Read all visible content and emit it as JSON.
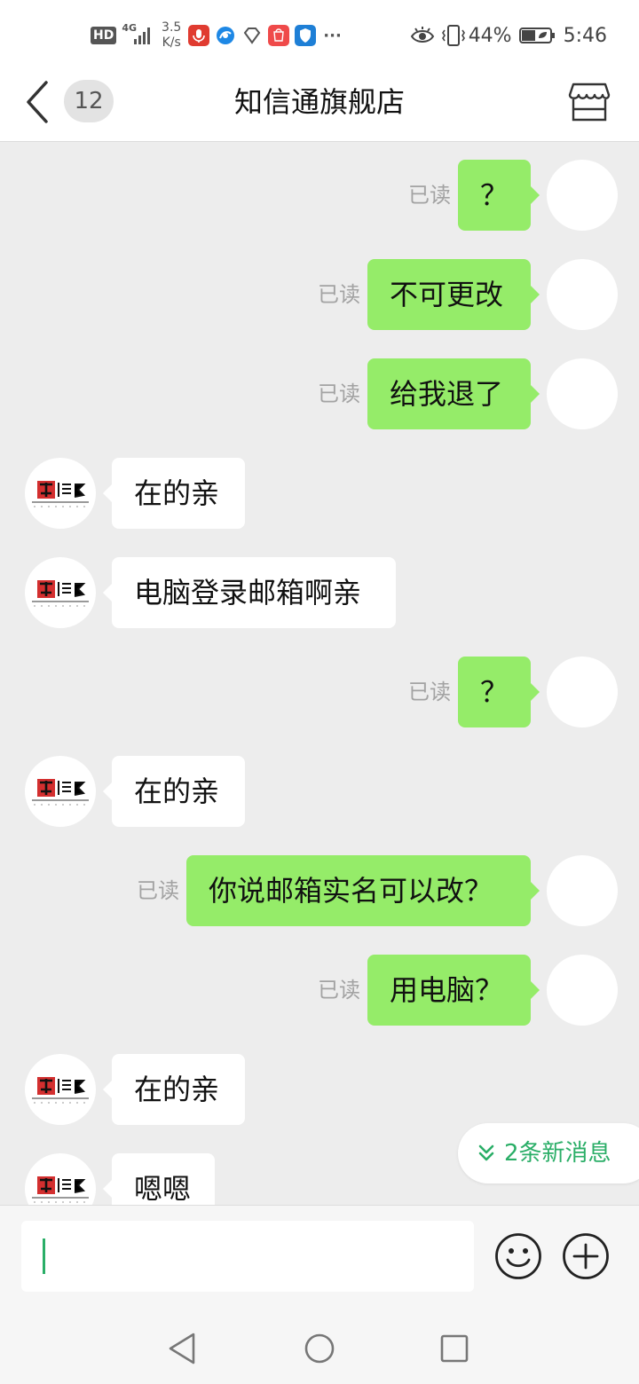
{
  "status_bar": {
    "hd": "HD",
    "network": "4G",
    "speed_value": "3.5",
    "speed_unit": "K/s",
    "more": "···",
    "battery": "44%",
    "time": "5:46"
  },
  "header": {
    "unread_count": "12",
    "title": "知信通旗舰店"
  },
  "messages": [
    {
      "from": "me",
      "text": "？",
      "status": "已读"
    },
    {
      "from": "me",
      "text": "不可更改",
      "status": "已读"
    },
    {
      "from": "me",
      "text": "给我退了",
      "status": "已读"
    },
    {
      "from": "shop",
      "text": "在的亲"
    },
    {
      "from": "shop",
      "text": "电脑登录邮箱啊亲"
    },
    {
      "from": "me",
      "text": "？",
      "status": "已读"
    },
    {
      "from": "shop",
      "text": "在的亲"
    },
    {
      "from": "me",
      "text": "你说邮箱实名可以改？",
      "status": "已读"
    },
    {
      "from": "me",
      "text": "用电脑？",
      "status": "已读"
    },
    {
      "from": "shop",
      "text": "在的亲"
    },
    {
      "from": "shop",
      "text": "嗯嗯"
    }
  ],
  "new_messages": {
    "label": "2条新消息"
  },
  "input": {
    "value": ""
  },
  "icons": {
    "back": "back-arrow-icon",
    "store": "store-icon",
    "emoji": "emoji-icon",
    "plus": "plus-icon"
  },
  "colors": {
    "outgoing_bubble": "#95ec69",
    "accent": "#2aae67",
    "chat_background": "#ededed"
  }
}
